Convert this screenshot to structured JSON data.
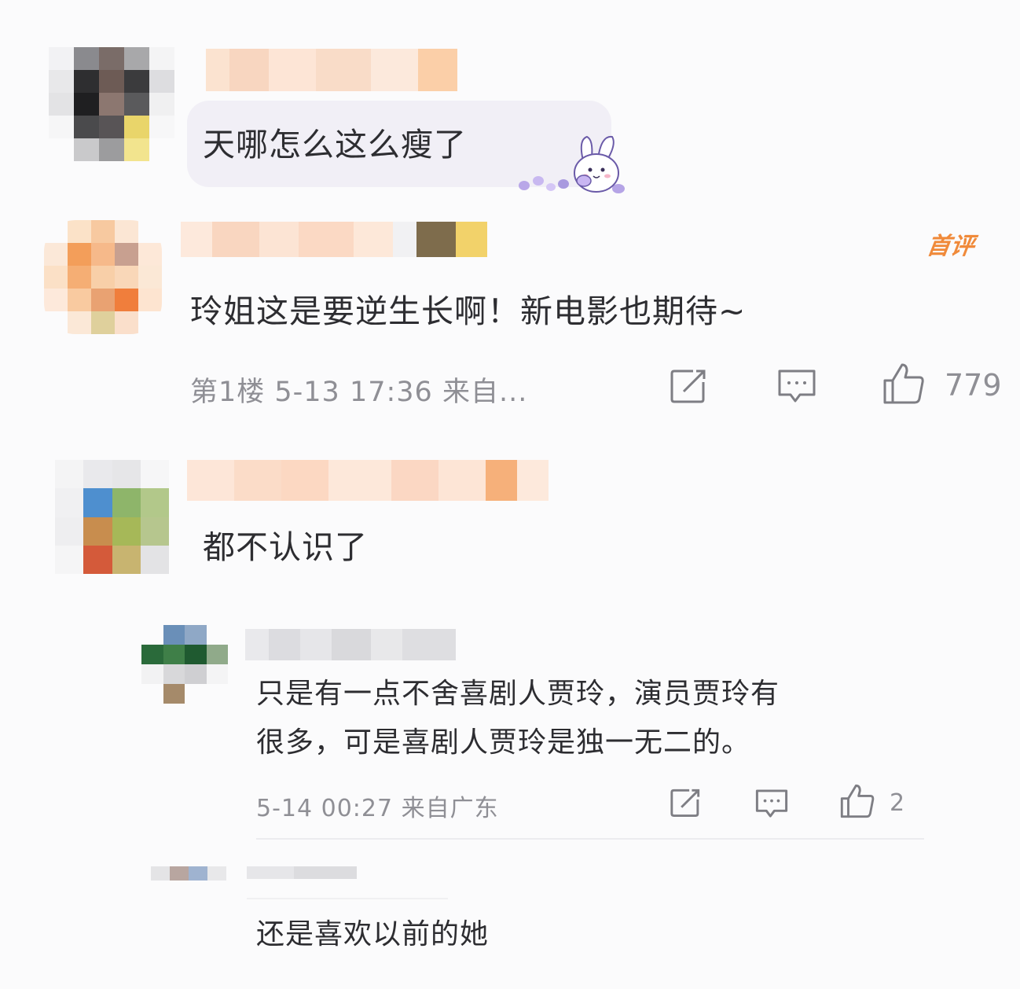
{
  "comments": [
    {
      "text": "天哪怎么这么瘦了"
    },
    {
      "text": "玲姐这是要逆生长啊！新电影也期待~",
      "badge": "首评",
      "meta": "第1楼 5-13 17:36 来自...",
      "like_count": "779"
    },
    {
      "text": "都不认识了",
      "replies": [
        {
          "text_line1": "只是有一点不舍喜剧人贾玲，演员贾玲有",
          "text_line2": "很多，可是喜剧人贾玲是独一无二的。",
          "meta": "5-14 00:27 来自广东",
          "like_count": "2"
        },
        {
          "text": "还是喜欢以前的她"
        }
      ]
    }
  ],
  "icons": [
    "share-icon",
    "comment-icon",
    "like-icon",
    "bunny-sticker-icon"
  ],
  "colors": {
    "accent_badge": "#f08a3a",
    "meta_gray": "#8f8f95",
    "bubble_bg": "#f1eff6"
  }
}
